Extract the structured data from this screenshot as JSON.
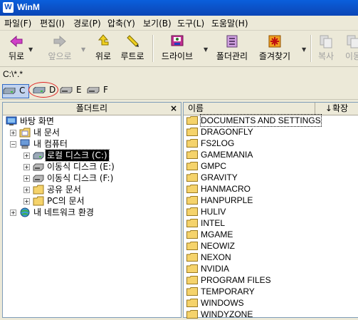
{
  "window": {
    "title": "WinM",
    "app_icon": "W"
  },
  "menu": [
    "파일(F)",
    "편집(I)",
    "경로(P)",
    "압축(Y)",
    "보기(B)",
    "도구(L)",
    "도움말(H)"
  ],
  "toolbar": {
    "back_label": "뒤로",
    "forward_label": "앞으로",
    "up_label": "위로",
    "root_label": "루트로",
    "drive_label": "드라이브",
    "folder_manage_label": "폴더관리",
    "favorites_label": "즐겨찾기",
    "copy_label": "복사",
    "move_label": "이동"
  },
  "path": "C:\\*.*",
  "drives": [
    {
      "letter": "C",
      "selected": true
    },
    {
      "letter": "D",
      "selected": false
    },
    {
      "letter": "E",
      "selected": false
    },
    {
      "letter": "F",
      "selected": false
    }
  ],
  "folder_tree": {
    "header": "폴더트리",
    "close": "×",
    "items": [
      {
        "label": "바탕 화면"
      },
      {
        "label": "내 문서"
      },
      {
        "label": "내 컴퓨터"
      },
      {
        "label": "로컬 디스크 (C:)"
      },
      {
        "label": "이동식 디스크 (E:)"
      },
      {
        "label": "이동식 디스크 (F:)"
      },
      {
        "label": "공유 문서"
      },
      {
        "label": "PC의 문서"
      },
      {
        "label": "내 네트워크 환경"
      }
    ]
  },
  "file_list": {
    "col_name": "이름",
    "col_ext": "↓확장",
    "folders": [
      "DOCUMENTS AND SETTINGS",
      "DRAGONFLY",
      "FS2LOG",
      "GAMEMANIA",
      "GMPC",
      "GRAVITY",
      "HANMACRO",
      "HANPURPLE",
      "HULIV",
      "INTEL",
      "MGAME",
      "NEOWIZ",
      "NEXON",
      "NVIDIA",
      "PROGRAM FILES",
      "TEMPORARY",
      "WINDOWS",
      "WINDYZONE"
    ]
  },
  "colors": {
    "title_bar": "#0a4fc4",
    "folder": "#f5d36b",
    "selection": "#000000"
  }
}
